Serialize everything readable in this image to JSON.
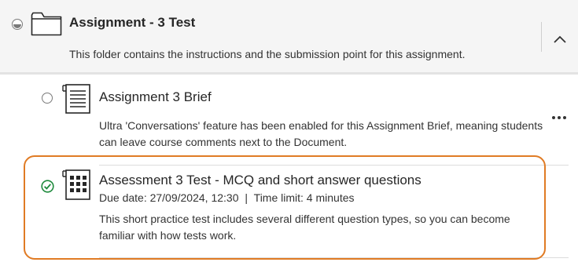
{
  "folder": {
    "title": "Assignment - 3 Test",
    "description": "This folder contains the instructions and the submission point for this assignment.",
    "icon": "folder-icon",
    "collapse_icon": "chevron-up-icon"
  },
  "items": [
    {
      "title": "Assignment 3 Brief",
      "icon": "document-icon",
      "status": "not-started",
      "body": "Ultra 'Conversations' feature has been enabled for this Assignment Brief, meaning students can leave course comments next to the Document.",
      "menu_icon": "more-options-icon"
    },
    {
      "title": "Assessment 3 Test - MCQ and short answer questions",
      "icon": "test-icon",
      "status": "completed",
      "due_date": "Due date: 27/09/2024, 12:30",
      "separator": "|",
      "time_limit": "Time limit: 4 minutes",
      "body": "This short practice test includes several different question types, so you can become familiar with how tests work."
    }
  ],
  "colors": {
    "highlight": "#e07b24",
    "success": "#1e8a3c",
    "header_bg": "#f5f5f5"
  }
}
